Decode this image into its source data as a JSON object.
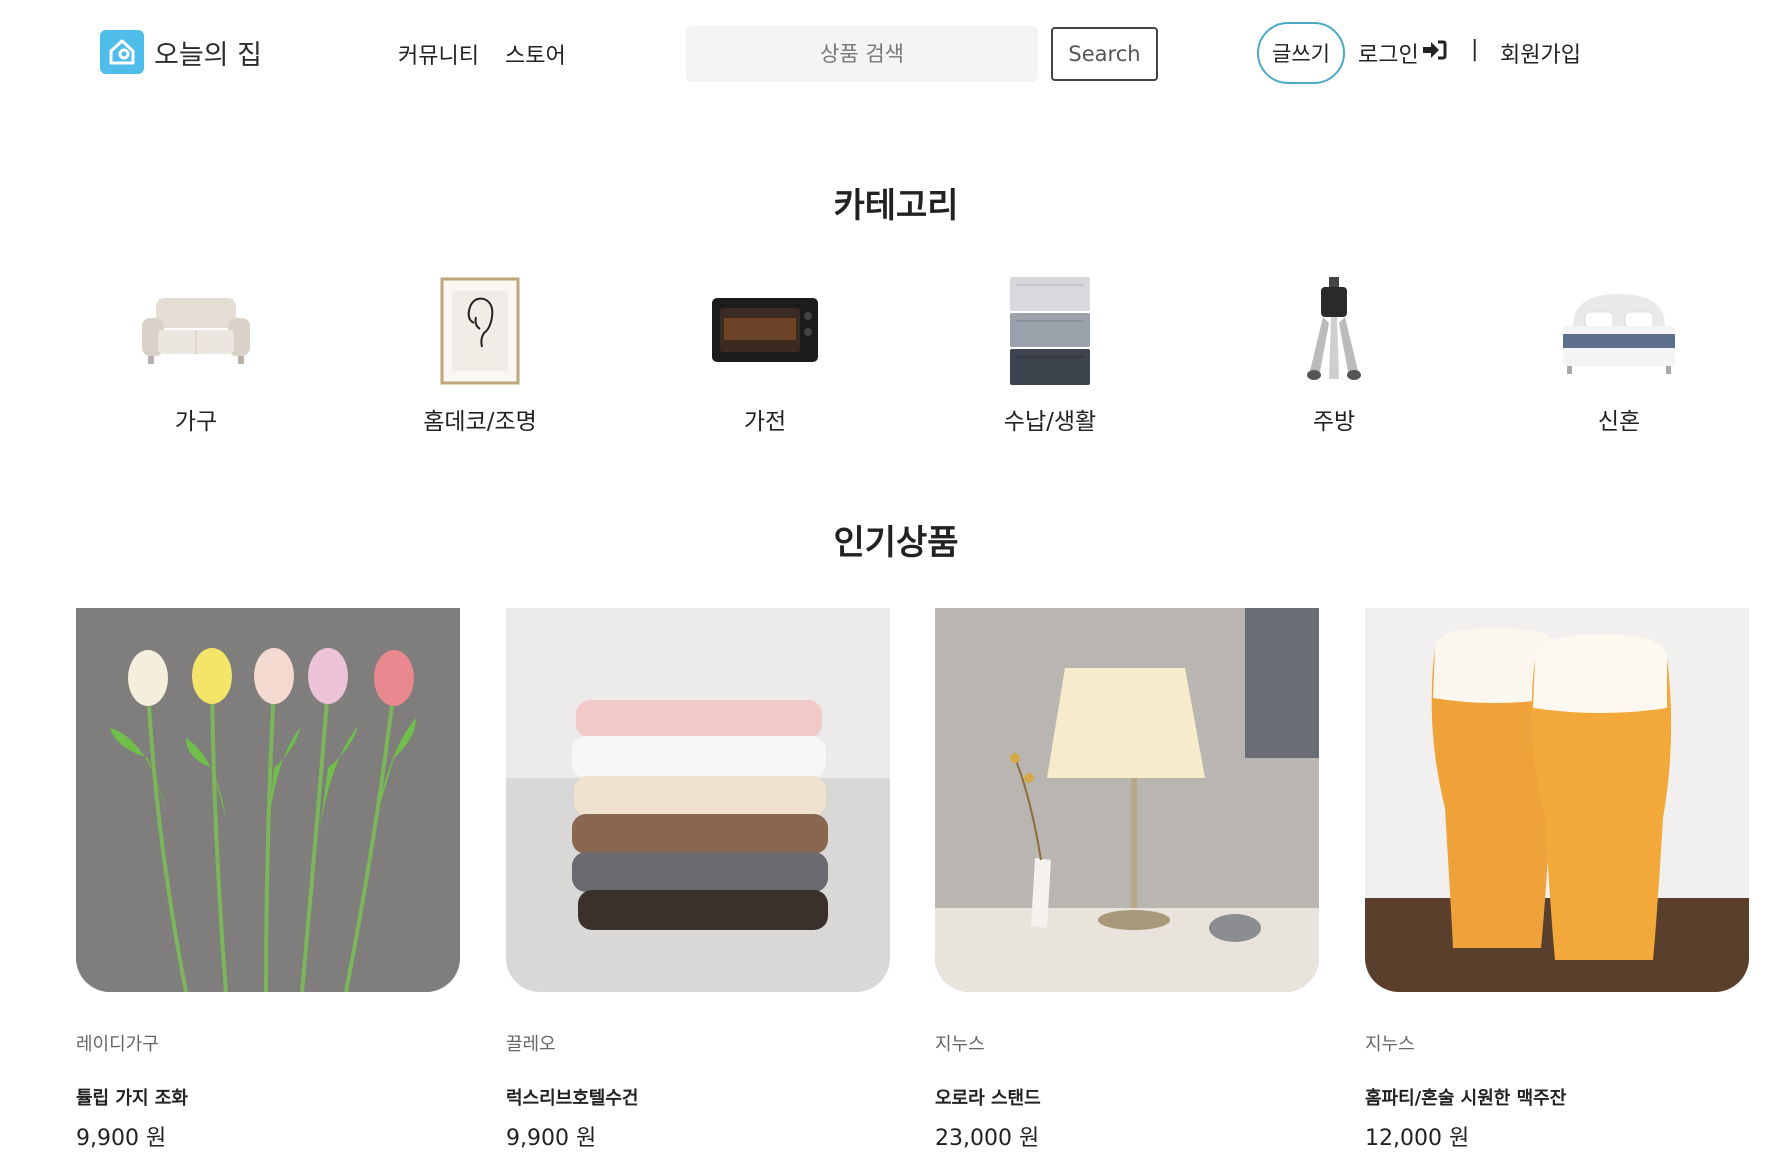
{
  "header": {
    "logo_text": "오늘의 집",
    "nav": [
      "커뮤니티",
      "스토어"
    ],
    "search_placeholder": "상품 검색",
    "search_button": "Search",
    "write_button": "글쓰기",
    "login": "로그인",
    "divider": "|",
    "signup": "회원가입",
    "accent_color": "#4fbde9"
  },
  "categories": {
    "title": "카테고리",
    "items": [
      {
        "label": "가구",
        "icon": "sofa-icon"
      },
      {
        "label": "홈데코/조명",
        "icon": "framed-art-icon"
      },
      {
        "label": "가전",
        "icon": "toaster-oven-icon"
      },
      {
        "label": "수납/생활",
        "icon": "storage-drawers-icon"
      },
      {
        "label": "주방",
        "icon": "kitchen-utensils-icon"
      },
      {
        "label": "신혼",
        "icon": "bed-icon"
      }
    ]
  },
  "popular": {
    "title": "인기상품",
    "items": [
      {
        "brand": "레이디가구",
        "name": "튤립 가지 조화",
        "price": "9,900 원",
        "image": "tulips"
      },
      {
        "brand": "끌레오",
        "name": "럭스리브호텔수건",
        "price": "9,900 원",
        "image": "towels"
      },
      {
        "brand": "지누스",
        "name": "오로라 스탠드",
        "price": "23,000 원",
        "image": "lamp"
      },
      {
        "brand": "지누스",
        "name": "홈파티/혼술 시원한 맥주잔",
        "price": "12,000 원",
        "image": "beer"
      }
    ]
  }
}
